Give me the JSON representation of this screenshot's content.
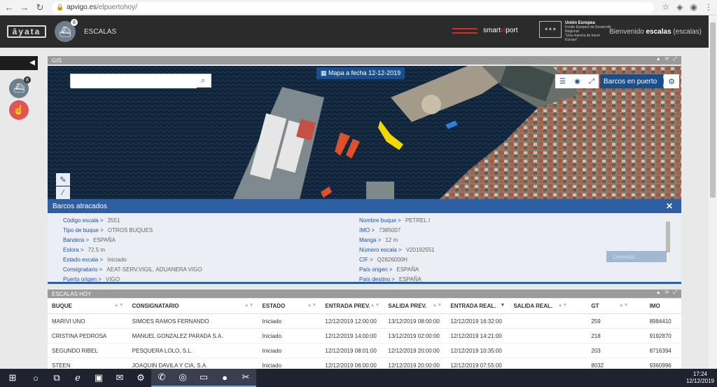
{
  "browser": {
    "url_domain": "apvigo.es",
    "url_path": "/elpuertohoy/"
  },
  "header": {
    "logo_text": "āyata",
    "module_badge": "8",
    "module_title": "ESCALAS",
    "smart_text_1": "smart ",
    "smart_text_2": "vi",
    "smart_text_3": "port",
    "eu_title": "Unión Europea",
    "eu_fund": "Fondo Europeo de Desarrollo Regional",
    "eu_motto": "\"Una manera de hacer Europa\"",
    "welcome_prefix": "Bienvenido ",
    "welcome_user": "escalas",
    "welcome_suffix": " (escalas)"
  },
  "sidebar": {
    "badge": "8"
  },
  "gis_panel": {
    "title": "GIS",
    "map_date_label": "Mapa a fecha 12-12-2019",
    "search_placeholder": "",
    "layer_label": "Barcos en puerto",
    "legend_label": "Leyenda"
  },
  "detail": {
    "title": "Barcos atracados",
    "left": [
      {
        "label": "Código escala >",
        "value": "2551"
      },
      {
        "label": "Tipo de buque >",
        "value": "OTROS BUQUES"
      },
      {
        "label": "Bandera >",
        "value": "ESPAÑA"
      },
      {
        "label": "Eslora >",
        "value": "72.5 m"
      },
      {
        "label": "Estado escala >",
        "value": "Iniciado"
      },
      {
        "label": "Consignatario >",
        "value": "AEAT-SERV.VIGIL. ADUANERA VIGO"
      },
      {
        "label": "Puerto origen >",
        "value": "VIGO"
      }
    ],
    "right": [
      {
        "label": "Nombre buque >",
        "value": "PETREL I"
      },
      {
        "label": "IMO >",
        "value": "7385007"
      },
      {
        "label": "Manga >",
        "value": "12 m"
      },
      {
        "label": "Número escala >",
        "value": "V20192551"
      },
      {
        "label": "CIF >",
        "value": "Q2826000H"
      },
      {
        "label": "País origen >",
        "value": "ESPAÑA"
      },
      {
        "label": "País destino >",
        "value": "ESPAÑA"
      }
    ]
  },
  "escalas_panel": {
    "title": "ESCALAS HOY",
    "columns": [
      "BUQUE",
      "CONSIGNATARIO",
      "ESTADO",
      "ENTRADA PREV.",
      "SALIDA PREV.",
      "ENTRADA REAL.",
      "SALIDA REAL.",
      "GT",
      "IMO"
    ],
    "rows": [
      [
        "MARIVI UNO",
        "SIMOES RAMOS FERNANDO",
        "Iniciado",
        "12/12/2019 12:00:00",
        "13/12/2019 08:00:00",
        "12/12/2019 16:32:00",
        "",
        "259",
        "8984410"
      ],
      [
        "CRISTINA PEDROSA",
        "MANUEL GONZALEZ PARADA S.A.",
        "Iniciado",
        "12/12/2019 14:00:00",
        "13/12/2019 02:00:00",
        "12/12/2019 14:21:00",
        "",
        "218",
        "9192870"
      ],
      [
        "SEGUNDO RIBEL",
        "PESQUERA LOLO, S.L.",
        "Iniciado",
        "12/12/2019 08:01:00",
        "12/12/2019 20:00:00",
        "12/12/2019 10:35:00",
        "",
        "203",
        "8716394"
      ],
      [
        "STEEN",
        "JOAQUIN DAVILA Y CIA, S.A.",
        "Iniciado",
        "12/12/2019 06:00:00",
        "12/12/2019 20:00:00",
        "12/12/2019 07:55:00",
        "",
        "8032",
        "9360996"
      ]
    ]
  },
  "taskbar": {
    "time": "17:24",
    "date": "12/12/2019"
  },
  "colors": {
    "brand_blue": "#2e5fa3",
    "accent_red": "#d92a2a"
  }
}
